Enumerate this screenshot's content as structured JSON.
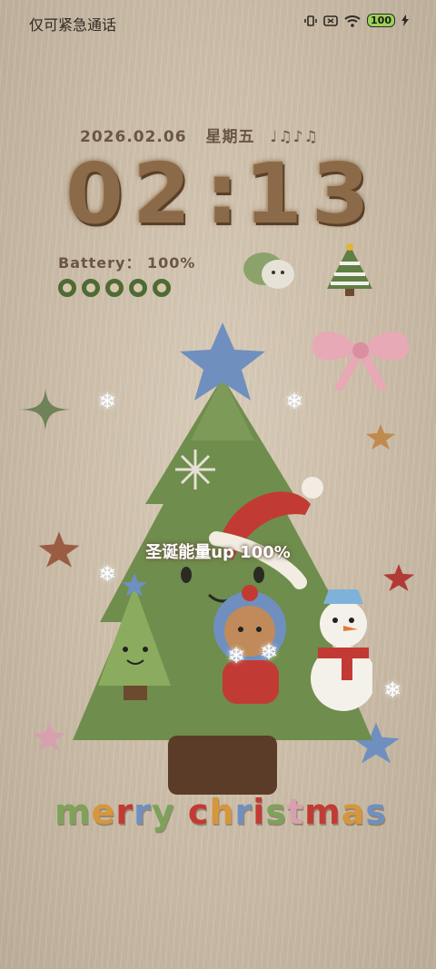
{
  "status_bar": {
    "carrier": "仅可紧急通话",
    "battery_level": "100",
    "icons": [
      "vibrate-icon",
      "no-sim-icon",
      "wifi-icon",
      "battery-icon",
      "charging-icon"
    ]
  },
  "lockscreen": {
    "date": "2026.02.06",
    "weekday": "星期五",
    "music_notes": "♩♫♪♫",
    "time_hours": "02",
    "time_separator": ":",
    "time_minutes": "13",
    "battery_text": "Battery： 100%",
    "battery_dots_filled": 5,
    "caption": "圣诞能量up 100%",
    "greeting_letters": [
      "m",
      "e",
      "r",
      "r",
      "y",
      " ",
      "c",
      "h",
      "r",
      "i",
      "s",
      "t",
      "m",
      "a",
      "s"
    ]
  },
  "colors": {
    "tree_green": "#6f8d4c",
    "trunk_brown": "#5b3c28",
    "text_brown": "#6b5644",
    "star_blue": "#6f8fbf",
    "hat_red": "#c23a34",
    "bow_pink": "#e7a9b5"
  }
}
